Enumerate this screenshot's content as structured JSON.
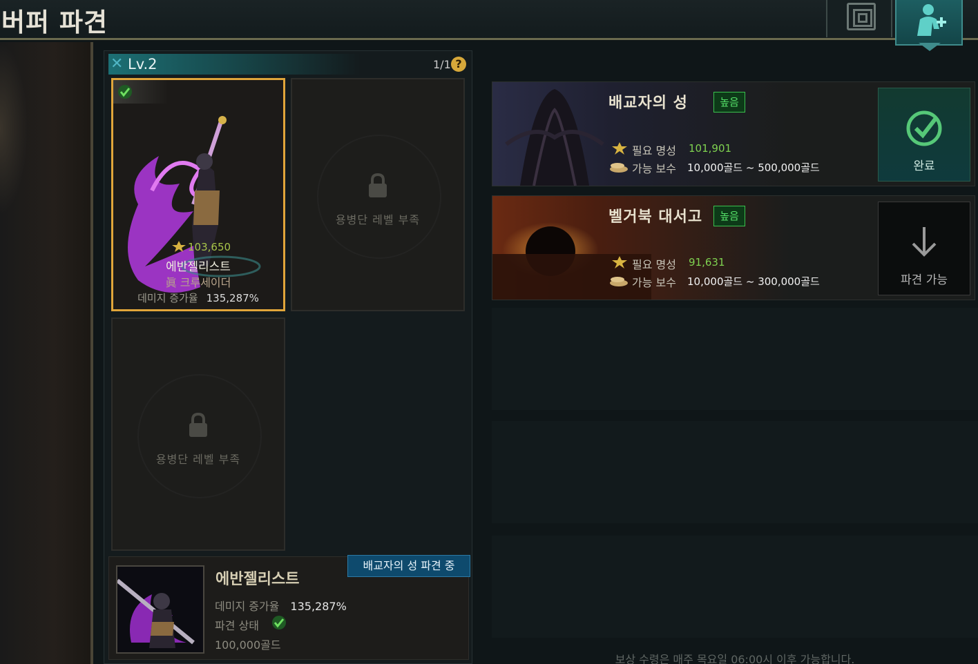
{
  "window": {
    "title": "버퍼 파견"
  },
  "topbar": {
    "dungeon_button_icon": "maze-icon",
    "dispatch_button_icon": "character-plus-icon"
  },
  "slots": {
    "level": "Lv.2",
    "count": "1/1",
    "help": "?",
    "items": [
      {
        "state": "active",
        "fame": "103,650",
        "name": "에반젤리스트",
        "title_prefix": "眞",
        "title": "크루세이더",
        "damage_label": "데미지 증가율",
        "damage_value": "135,287%"
      },
      {
        "state": "locked",
        "lock_text": "용병단 레벨 부족"
      },
      {
        "state": "locked",
        "lock_text": "용병단 레벨 부족"
      }
    ]
  },
  "selected": {
    "status_tag": "배교자의 성 파견 중",
    "name": "에반젤리스트",
    "damage_label": "데미지 증가율",
    "damage_value": "135,287%",
    "dispatch_label": "파견 상태",
    "gold": "100,000골드"
  },
  "dungeons": [
    {
      "name": "배교자의 성",
      "tag": "높음",
      "req_label": "필요 명성",
      "req_value": "101,901",
      "reward_label": "가능 보수",
      "reward_value": "10,000골드 ~ 500,000골드",
      "action_label": "완료",
      "action_state": "done"
    },
    {
      "name": "벨거북 대서고",
      "tag": "높음",
      "req_label": "필요 명성",
      "req_value": "91,631",
      "reward_label": "가능 보수",
      "reward_value": "10,000골드 ~ 300,000골드",
      "action_label": "파견 가능",
      "action_state": "available"
    }
  ],
  "footer": {
    "note": "보상 수령은 매주 목요일 06:00시 이후 가능합니다."
  },
  "colors": {
    "accent_teal": "#1c6f74",
    "active_border": "#e0a53a",
    "tag_green": "#56e36a",
    "status_blue": "#0e4a6d"
  }
}
